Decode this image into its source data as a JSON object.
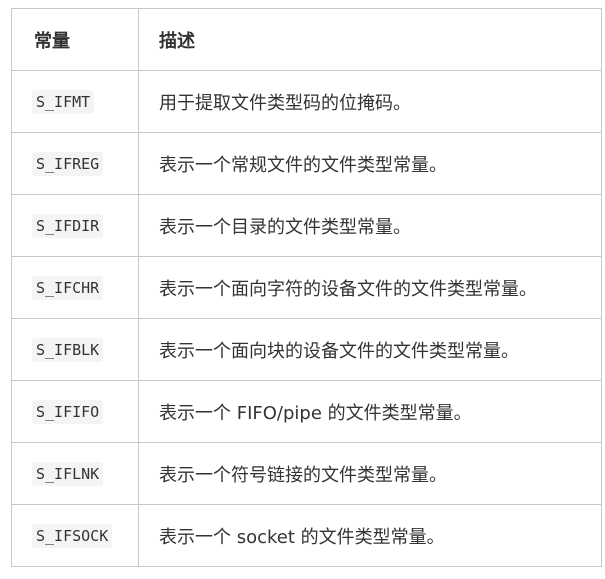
{
  "table": {
    "headers": {
      "constant": "常量",
      "description": "描述"
    },
    "rows": [
      {
        "constant": "S_IFMT",
        "description": "用于提取文件类型码的位掩码。"
      },
      {
        "constant": "S_IFREG",
        "description": "表示一个常规文件的文件类型常量。"
      },
      {
        "constant": "S_IFDIR",
        "description": "表示一个目录的文件类型常量。"
      },
      {
        "constant": "S_IFCHR",
        "description": "表示一个面向字符的设备文件的文件类型常量。"
      },
      {
        "constant": "S_IFBLK",
        "description": "表示一个面向块的设备文件的文件类型常量。"
      },
      {
        "constant": "S_IFIFO",
        "description": "表示一个 FIFO/pipe 的文件类型常量。"
      },
      {
        "constant": "S_IFLNK",
        "description": "表示一个符号链接的文件类型常量。"
      },
      {
        "constant": "S_IFSOCK",
        "description": "表示一个 socket 的文件类型常量。"
      }
    ]
  },
  "colors": {
    "border": "#c8c8c8",
    "text": "#333333",
    "code_background": "#f3f4f4"
  }
}
